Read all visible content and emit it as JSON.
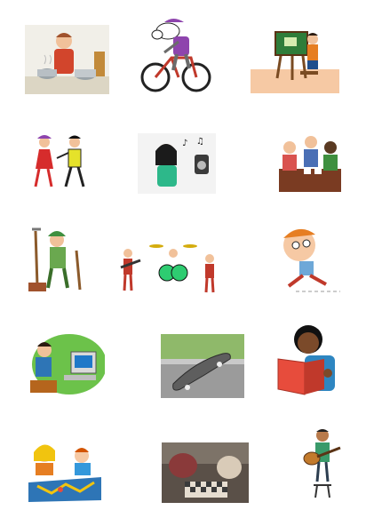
{
  "images": [
    {
      "name": "cooking-clipart",
      "icon": "chef-with-pots"
    },
    {
      "name": "cycling-clipart",
      "icon": "cyclist-on-bike"
    },
    {
      "name": "painting-clipart",
      "icon": "painter-at-easel"
    },
    {
      "name": "dancing-clipart",
      "icon": "dancing-couple"
    },
    {
      "name": "listening-music-clipart",
      "icon": "girl-with-music-player"
    },
    {
      "name": "card-games-clipart",
      "icon": "people-playing-cards"
    },
    {
      "name": "gardening-clipart",
      "icon": "gardener-with-tools"
    },
    {
      "name": "band-clipart",
      "icon": "rock-band"
    },
    {
      "name": "running-clipart",
      "icon": "running-boy"
    },
    {
      "name": "computer-clipart",
      "icon": "boy-at-computer"
    },
    {
      "name": "skateboard-photo",
      "icon": "skateboard"
    },
    {
      "name": "reading-clipart",
      "icon": "boy-reading-book"
    },
    {
      "name": "board-game-clipart",
      "icon": "kids-playing-board-game"
    },
    {
      "name": "chess-photo",
      "icon": "kids-playing-chess"
    },
    {
      "name": "guitar-clipart",
      "icon": "boy-playing-guitar"
    }
  ]
}
